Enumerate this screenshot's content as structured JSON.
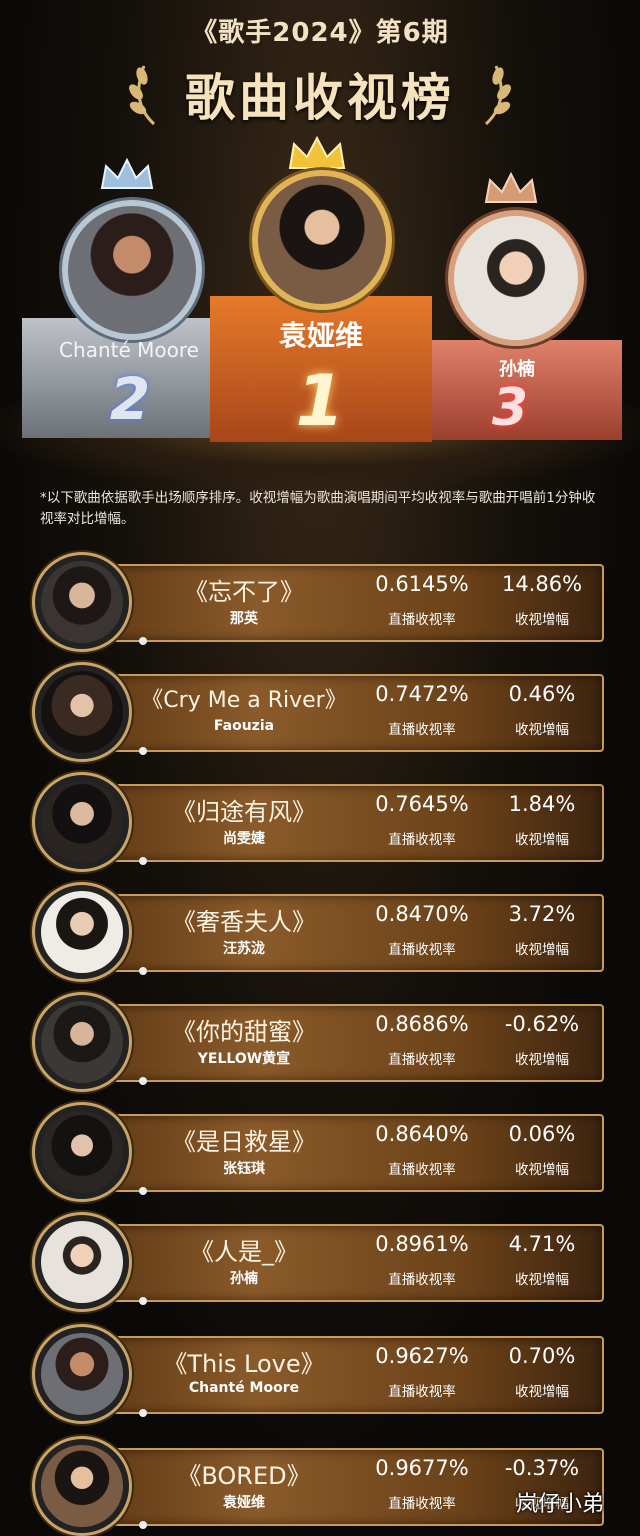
{
  "header": {
    "episode": "《歌手2024》第6期",
    "title": "歌曲收视榜"
  },
  "podium": {
    "first": {
      "name": "袁娅维",
      "rank": "1"
    },
    "second": {
      "name": "Chanté Moore",
      "rank": "2"
    },
    "third": {
      "name": "孙楠",
      "rank": "3"
    }
  },
  "note": "*以下歌曲依据歌手出场顺序排序。收视增幅为歌曲演唱期间平均收视率与歌曲开唱前1分钟收视率对比增幅。",
  "labels": {
    "rate": "直播收视率",
    "gain": "收视增幅"
  },
  "rows": [
    {
      "song": "《忘不了》",
      "singer": "那英",
      "rate": "0.6145%",
      "gain": "14.86%"
    },
    {
      "song": "《Cry Me a River》",
      "singer": "Faouzia",
      "rate": "0.7472%",
      "gain": "0.46%"
    },
    {
      "song": "《归途有风》",
      "singer": "尚雯婕",
      "rate": "0.7645%",
      "gain": "1.84%"
    },
    {
      "song": "《奢香夫人》",
      "singer": "汪苏泷",
      "rate": "0.8470%",
      "gain": "3.72%"
    },
    {
      "song": "《你的甜蜜》",
      "singer": "YELLOW黄宣",
      "rate": "0.8686%",
      "gain": "-0.62%"
    },
    {
      "song": "《是日救星》",
      "singer": "张钰琪",
      "rate": "0.8640%",
      "gain": "0.06%"
    },
    {
      "song": "《人是_》",
      "singer": "孙楠",
      "rate": "0.8961%",
      "gain": "4.71%"
    },
    {
      "song": "《This Love》",
      "singer": "Chanté Moore",
      "rate": "0.9627%",
      "gain": "0.70%"
    },
    {
      "song": "《BORED》",
      "singer": "袁娅维",
      "rate": "0.9677%",
      "gain": "-0.37%"
    }
  ],
  "watermark": "岚仔小弟"
}
